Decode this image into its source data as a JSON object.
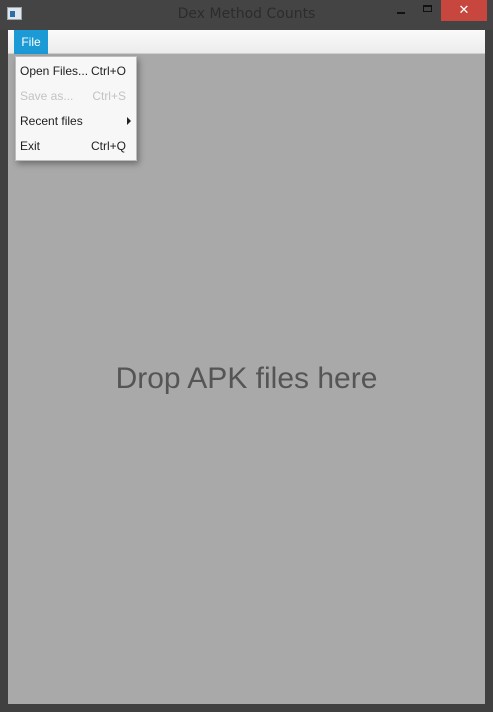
{
  "window": {
    "title": "Dex Method Counts",
    "close_glyph": "✕"
  },
  "menubar": {
    "file_label": "File"
  },
  "file_menu": {
    "items": [
      {
        "label": "Open Files...",
        "shortcut": "Ctrl+O",
        "enabled": true
      },
      {
        "label": "Save as...",
        "shortcut": "Ctrl+S",
        "enabled": false
      },
      {
        "label": "Recent files",
        "shortcut": "",
        "enabled": true,
        "submenu_icon": "chevron-right-icon"
      },
      {
        "label": "Exit",
        "shortcut": "Ctrl+Q",
        "enabled": true
      }
    ]
  },
  "main": {
    "drop_hint": "Drop APK files here"
  },
  "colors": {
    "accent": "#1b9ad6",
    "close_button": "#c7463e",
    "drop_area": "#a9a9a9"
  }
}
